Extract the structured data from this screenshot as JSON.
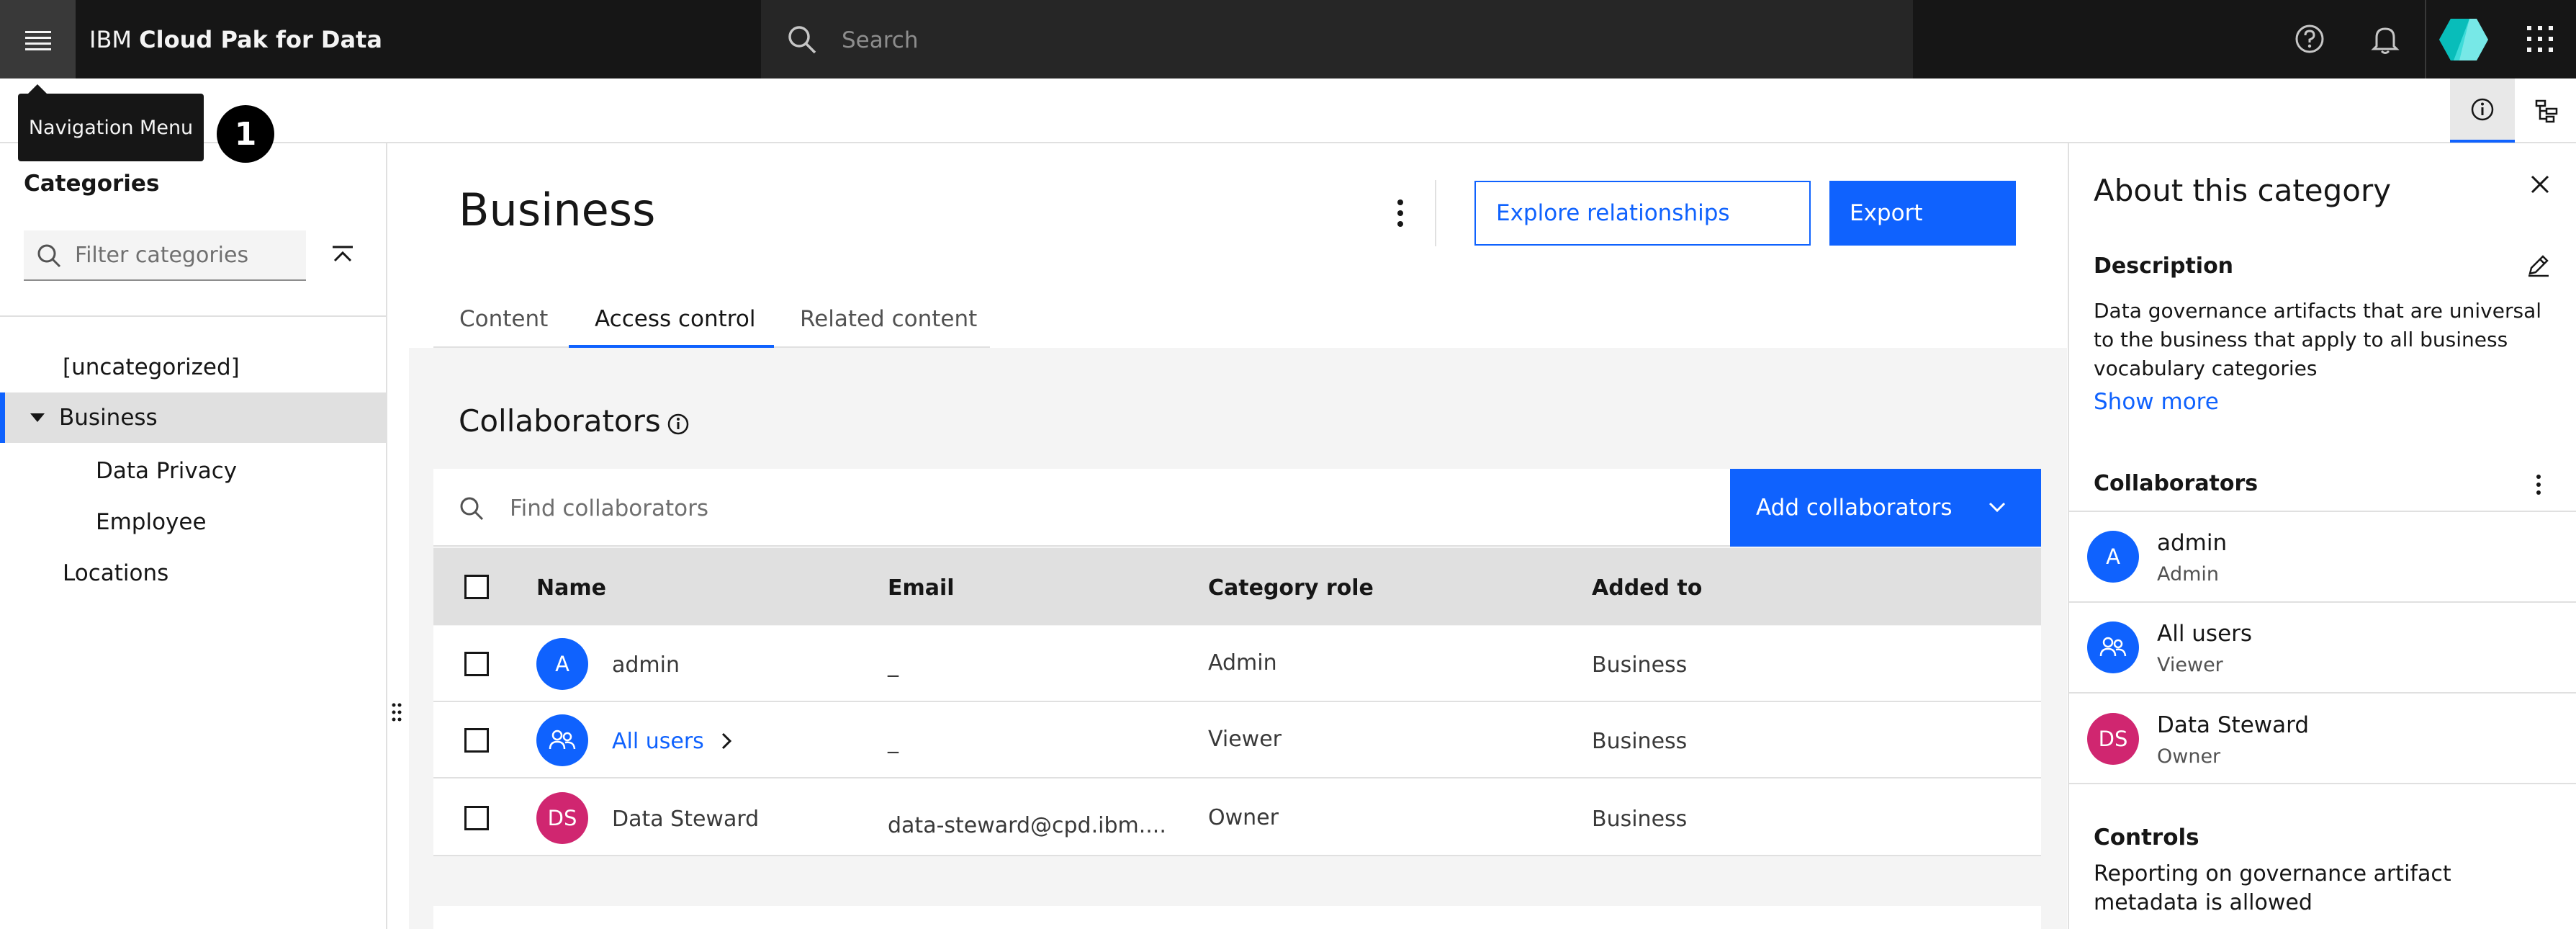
{
  "topbar": {
    "brand_prefix": "IBM",
    "brand_name": "Cloud Pak for Data",
    "search_placeholder": "Search"
  },
  "tooltip": {
    "text": "Navigation Menu",
    "step": "1"
  },
  "categories": {
    "title": "Categories",
    "filter_placeholder": "Filter categories",
    "items": [
      {
        "label": "[uncategorized]"
      },
      {
        "label": "Business"
      },
      {
        "label": "Data Privacy"
      },
      {
        "label": "Employee"
      },
      {
        "label": "Locations"
      }
    ]
  },
  "main": {
    "title": "Business",
    "explore_label": "Explore relationships",
    "export_label": "Export",
    "tabs": [
      {
        "label": "Content"
      },
      {
        "label": "Access control"
      },
      {
        "label": "Related content"
      }
    ],
    "collaborators_title": "Collaborators",
    "find_placeholder": "Find collaborators",
    "add_label": "Add collaborators",
    "columns": [
      "Name",
      "Email",
      "Category role",
      "Added to"
    ],
    "rows": [
      {
        "initials": "A",
        "name": "admin",
        "email": "_",
        "role": "Admin",
        "added_to": "Business"
      },
      {
        "initials": "",
        "name": "All users",
        "email": "_",
        "role": "Viewer",
        "added_to": "Business"
      },
      {
        "initials": "DS",
        "name": "Data Steward",
        "email": "data-steward@cpd.ibm....",
        "role": "Owner",
        "added_to": "Business"
      }
    ]
  },
  "about": {
    "title": "About this category",
    "description_label": "Description",
    "description": "Data governance artifacts that are universal to the business that apply to all business vocabulary categories",
    "show_more": "Show more",
    "collaborators_label": "Collaborators",
    "collaborators": [
      {
        "initials": "A",
        "name": "admin",
        "role": "Admin"
      },
      {
        "initials": "",
        "name": "All users",
        "role": "Viewer"
      },
      {
        "initials": "DS",
        "name": "Data Steward",
        "role": "Owner"
      }
    ],
    "controls_label": "Controls",
    "controls_text": "Reporting on governance artifact metadata is allowed"
  },
  "colors": {
    "accent": "#0f62fe",
    "pink": "#d02670",
    "dark": "#161616"
  }
}
